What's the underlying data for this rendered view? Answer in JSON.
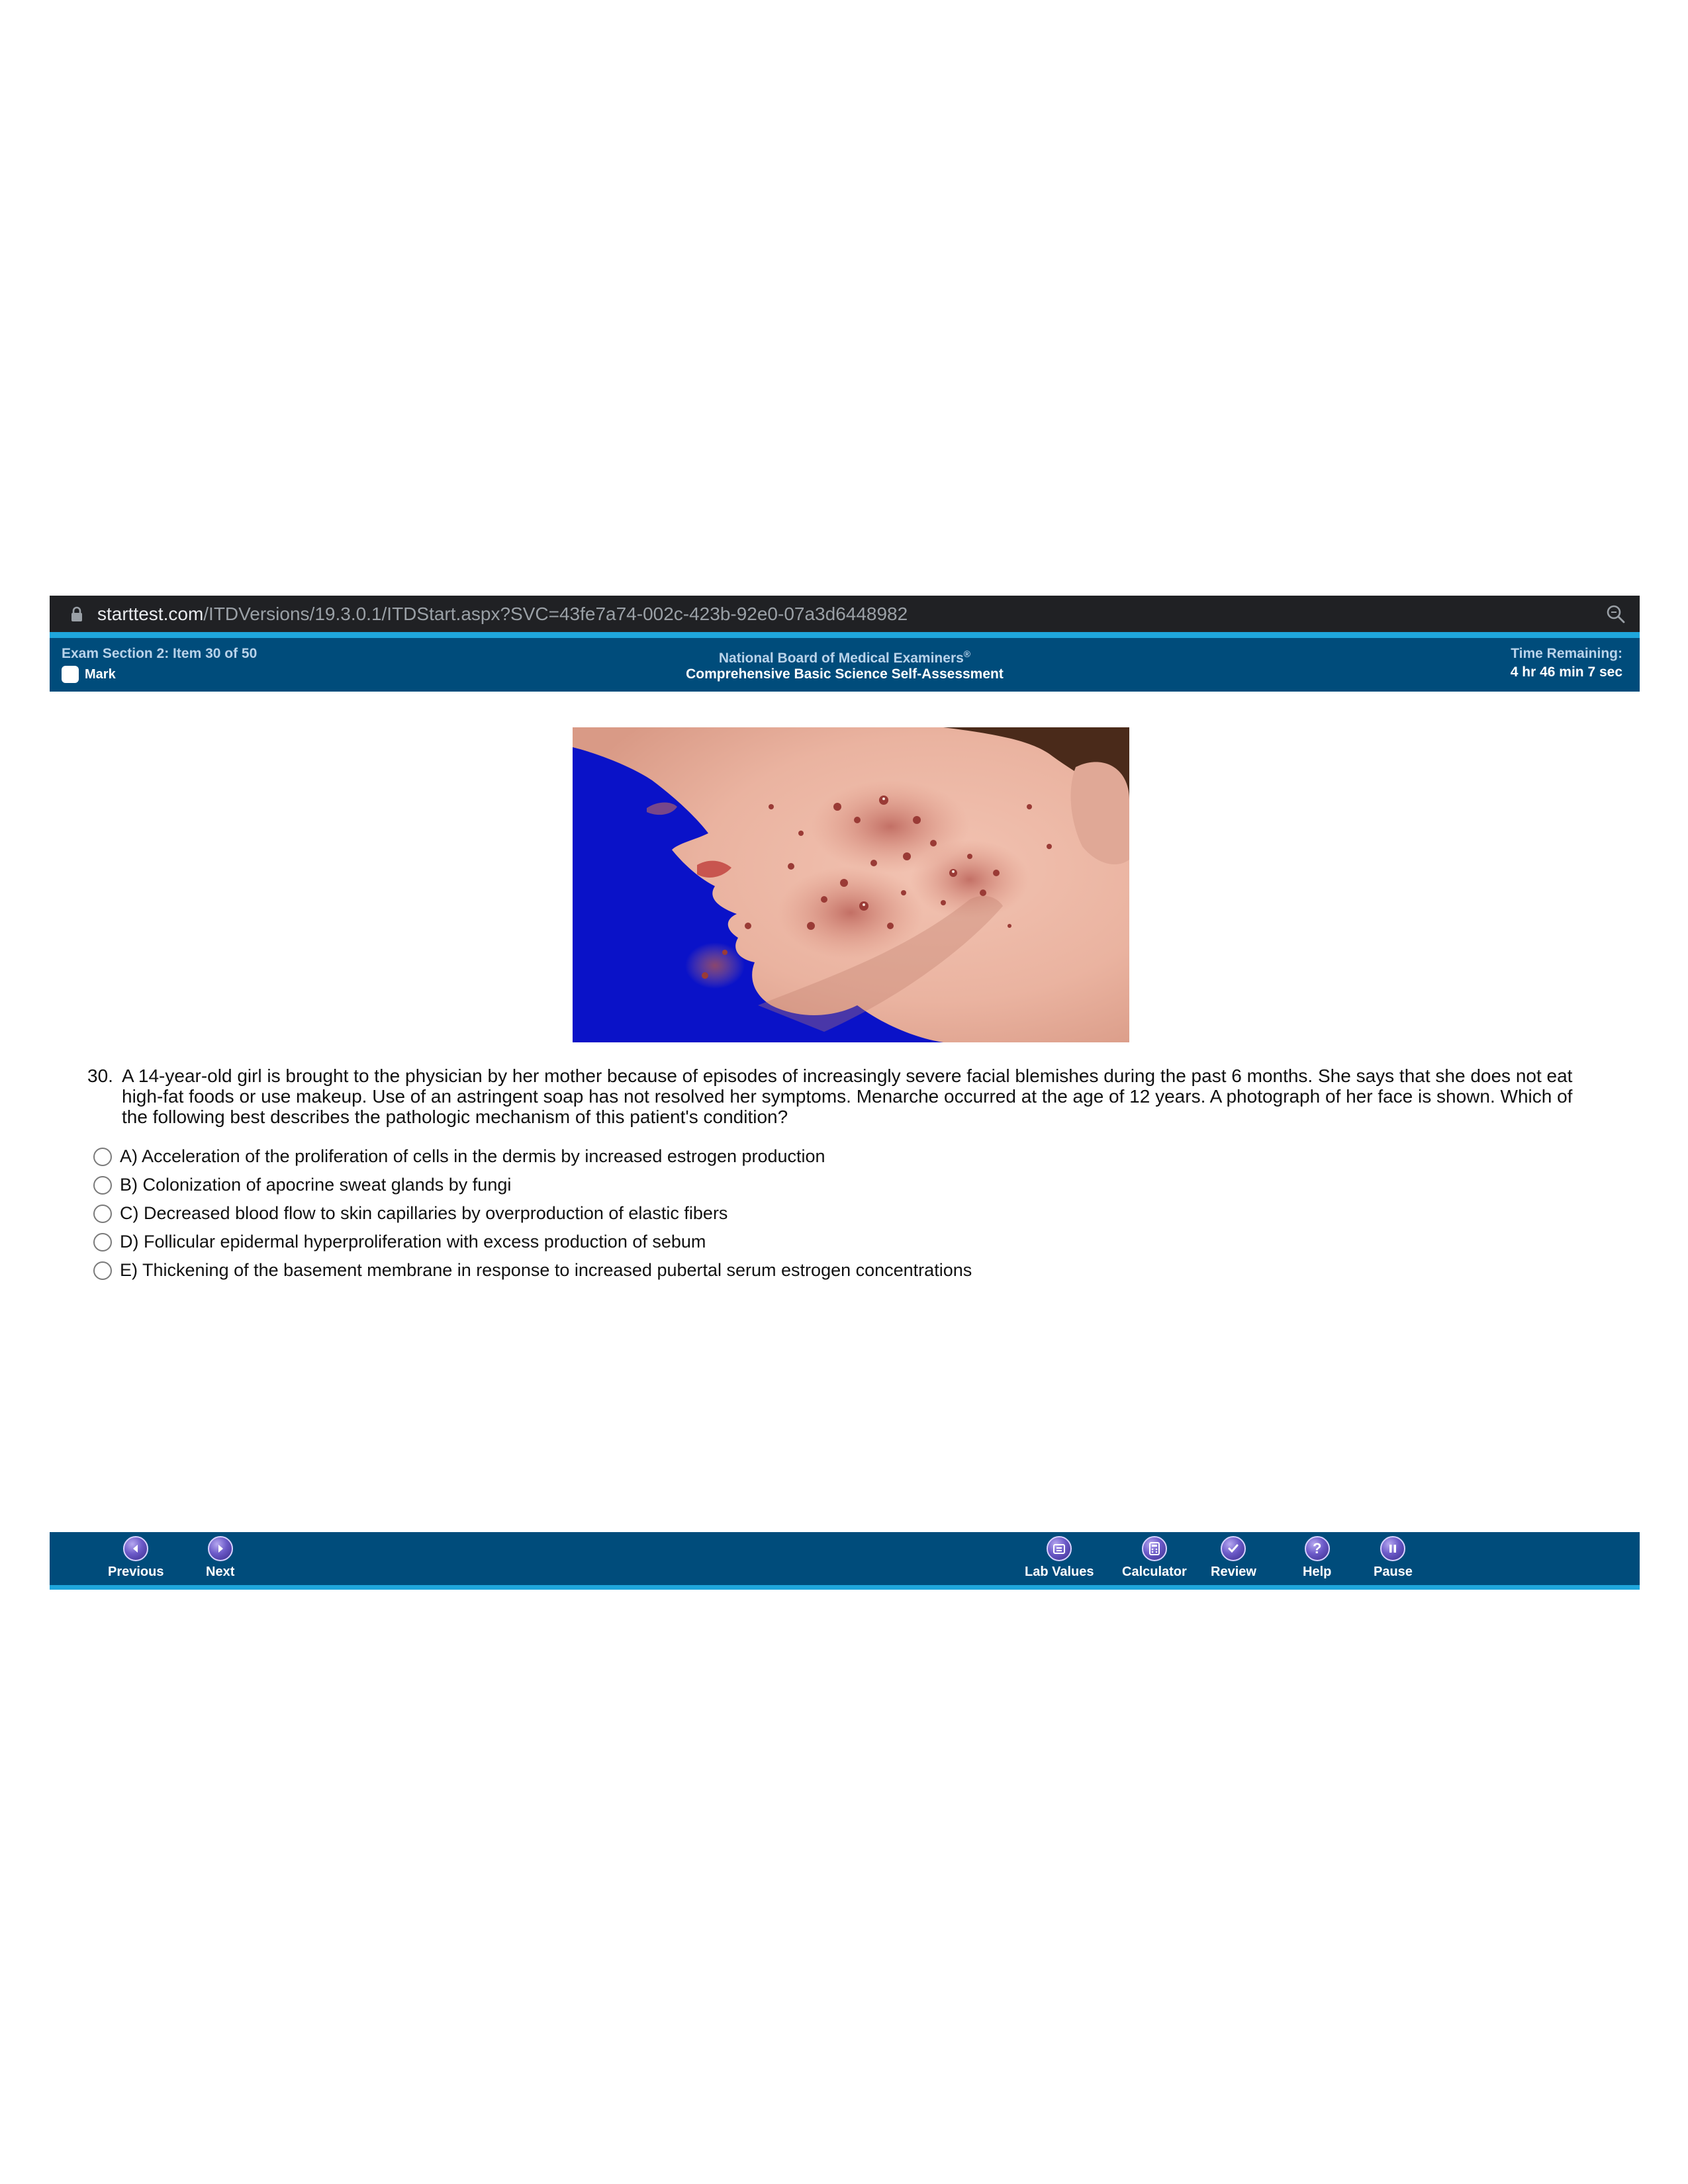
{
  "browser": {
    "url_host": "starttest.com",
    "url_path": "/ITDVersions/19.3.0.1/ITDStart.aspx?SVC=43fe7a74-002c-423b-92e0-07a3d6448982"
  },
  "header": {
    "item_label": "Exam Section 2: Item 30 of 50",
    "mark_label": "Mark",
    "org_name": "National Board of Medical Examiners",
    "org_mark": "®",
    "exam_name": "Comprehensive Basic Science Self-Assessment",
    "time_label": "Time Remaining:",
    "time_value": "4 hr 46 min 7 sec"
  },
  "question": {
    "number": "30.",
    "text": "A 14-year-old girl is brought to the physician by her mother because of episodes of increasingly severe facial blemishes during the past 6 months. She says that she does not eat high-fat foods or use makeup. Use of an astringent soap has not resolved her symptoms. Menarche occurred at the age of 12 years. A photograph of her face is shown. Which of the following best describes the pathologic mechanism of this patient's condition?",
    "options": [
      {
        "label": "A) Acceleration of the proliferation of cells in the dermis by increased estrogen production"
      },
      {
        "label": "B) Colonization of apocrine sweat glands by fungi"
      },
      {
        "label": "C) Decreased blood flow to skin capillaries by overproduction of elastic fibers"
      },
      {
        "label": "D) Follicular epidermal hyperproliferation with excess production of sebum"
      },
      {
        "label": "E) Thickening of the basement membrane in response to increased pubertal serum estrogen concentrations"
      }
    ]
  },
  "toolbar": {
    "previous": "Previous",
    "next": "Next",
    "lab_values": "Lab Values",
    "calculator": "Calculator",
    "review": "Review",
    "help": "Help",
    "pause": "Pause"
  },
  "colors": {
    "header_bg": "#004c7b",
    "accent_line": "#1fa6dc",
    "url_bar_bg": "#202124"
  }
}
